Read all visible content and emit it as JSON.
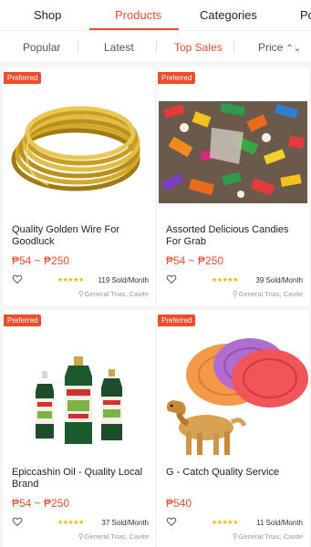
{
  "tabs": [
    {
      "label": "Shop"
    },
    {
      "label": "Products"
    },
    {
      "label": "Categories"
    },
    {
      "label": "Po"
    }
  ],
  "sort": [
    {
      "label": "Popular"
    },
    {
      "label": "Latest"
    },
    {
      "label": "Top Sales"
    },
    {
      "label": "Price"
    }
  ],
  "products": [
    {
      "badge": "Preferred",
      "title": "Quality Golden Wire For Goodluck",
      "price": "₱54 ~ ₱250",
      "sold": "119 Sold/Month",
      "location": "General Trias, Cavite",
      "stars": "★★★★★",
      "image": "golden-wire"
    },
    {
      "badge": "Preferred",
      "title": "Assorted Delicious Candies For Grab",
      "price": "₱54 ~ ₱250",
      "sold": "39 Sold/Month",
      "location": "General Trias, Cavite",
      "stars": "★★★★★",
      "image": "candies"
    },
    {
      "badge": "Preferred",
      "title": "Epiccashin Oil - Quality Local Brand",
      "price": "₱54 ~ ₱250",
      "sold": "37 Sold/Month",
      "location": "General Trias, Cavite",
      "stars": "★★★★★",
      "image": "oil-bottles"
    },
    {
      "badge": "Preferred",
      "title": "G - Catch Quality Service",
      "price": "₱540",
      "sold": "11 Sold/Month",
      "location": "General Trias, Cavite",
      "stars": "★★★★★",
      "image": "frisbee-dog"
    }
  ],
  "colors": {
    "accent": "#ee4d2d",
    "star": "#f5b400"
  }
}
